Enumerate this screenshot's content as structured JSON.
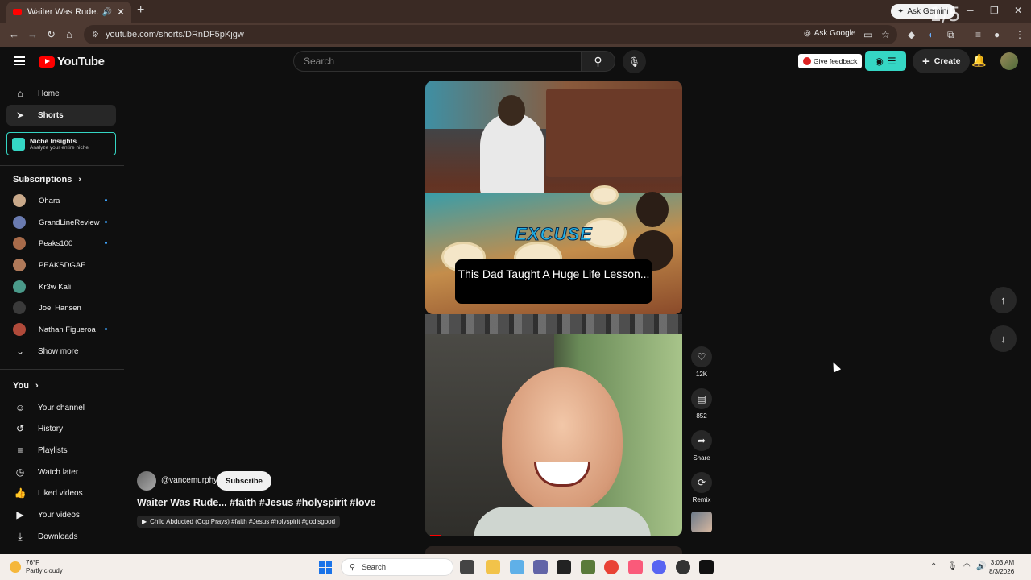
{
  "browser": {
    "tab_title": "Waiter Was Rude... #faith #",
    "url": "youtube.com/shorts/DRnDF5pKjgw",
    "ask_gemini": "Ask Gemini",
    "ask_google": "Ask Google",
    "overlay_counter": "1/5"
  },
  "header": {
    "logo_text": "YouTube",
    "search_placeholder": "Search",
    "feedback_label": "Give feedback",
    "create_label": "Create"
  },
  "sidebar": {
    "nav": [
      {
        "label": "Home",
        "icon": "home-icon"
      },
      {
        "label": "Shorts",
        "icon": "shorts-icon"
      }
    ],
    "niche": {
      "title": "Niche Insights",
      "subtitle": "Analyze your entire niche"
    },
    "subscriptions_title": "Subscriptions",
    "subscriptions": [
      {
        "name": "Ohara",
        "color": "#c9a98a",
        "live": true
      },
      {
        "name": "GrandLineReview",
        "color": "#6a7bb0",
        "live": true
      },
      {
        "name": "Peaks100",
        "color": "#a86b4a",
        "live": true
      },
      {
        "name": "PEAKSDGAF",
        "color": "#b07a5a",
        "live": false
      },
      {
        "name": "Kr3w Kali",
        "color": "#4a9a8a",
        "live": false
      },
      {
        "name": "Joel Hansen",
        "color": "#3a3a3a",
        "live": false
      },
      {
        "name": "Nathan Figueroa",
        "color": "#b04a3a",
        "live": true
      }
    ],
    "show_more": "Show more",
    "you_title": "You",
    "you_items": [
      {
        "label": "Your channel",
        "icon": "channel-icon"
      },
      {
        "label": "History",
        "icon": "history-icon"
      },
      {
        "label": "Playlists",
        "icon": "playlists-icon"
      },
      {
        "label": "Watch later",
        "icon": "watch-later-icon"
      },
      {
        "label": "Liked videos",
        "icon": "like-icon"
      },
      {
        "label": "Your videos",
        "icon": "your-videos-icon"
      },
      {
        "label": "Downloads",
        "icon": "download-icon"
      }
    ]
  },
  "video1": {
    "overlay_word": "EXCUSE",
    "caption": "This Dad Taught A Huge Life Lesson..."
  },
  "current_short": {
    "channel": "@vancemurphy",
    "subscribe_label": "Subscribe",
    "title": "Waiter Was Rude... #faith #Jesus #holyspirit #love",
    "linked_video": "Child Abducted (Cop Prays) #faith #Jesus #holyspirit #godisgood",
    "likes": "12K",
    "comments": "852",
    "share_label": "Share",
    "remix_label": "Remix"
  },
  "taskbar": {
    "temperature": "76°F",
    "weather": "Partly cloudy",
    "search_label": "Search",
    "time": "3:03 AM",
    "date": "8/3/2026"
  }
}
